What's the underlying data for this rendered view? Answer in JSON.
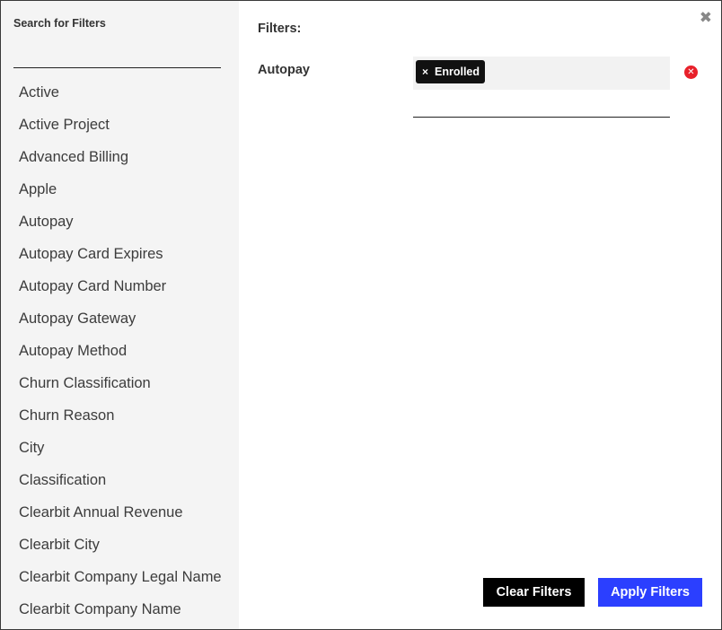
{
  "sidebar": {
    "search_label": "Search for Filters",
    "search_value": "",
    "search_placeholder": "",
    "items": [
      "Active",
      "Active Project",
      "Advanced Billing",
      "Apple",
      "Autopay",
      "Autopay Card Expires",
      "Autopay Card Number",
      "Autopay Gateway",
      "Autopay Method",
      "Churn Classification",
      "Churn Reason",
      "City",
      "Classification",
      "Clearbit Annual Revenue",
      "Clearbit City",
      "Clearbit Company Legal Name",
      "Clearbit Company Name"
    ]
  },
  "main": {
    "close_icon": "close-icon",
    "title": "Filters:",
    "active_filter": {
      "label": "Autopay",
      "chips": [
        {
          "remove_glyph": "×",
          "label": "Enrolled"
        }
      ],
      "input_value": "",
      "remove_icon": "remove-circle-icon",
      "remove_color": "#e8202a"
    },
    "buttons": {
      "clear_label": "Clear Filters",
      "apply_label": "Apply Filters"
    }
  },
  "colors": {
    "sidebar_bg": "#f4f4f4",
    "apply_button": "#2b3fff",
    "clear_button": "#000000",
    "chip_bg": "#111111"
  }
}
